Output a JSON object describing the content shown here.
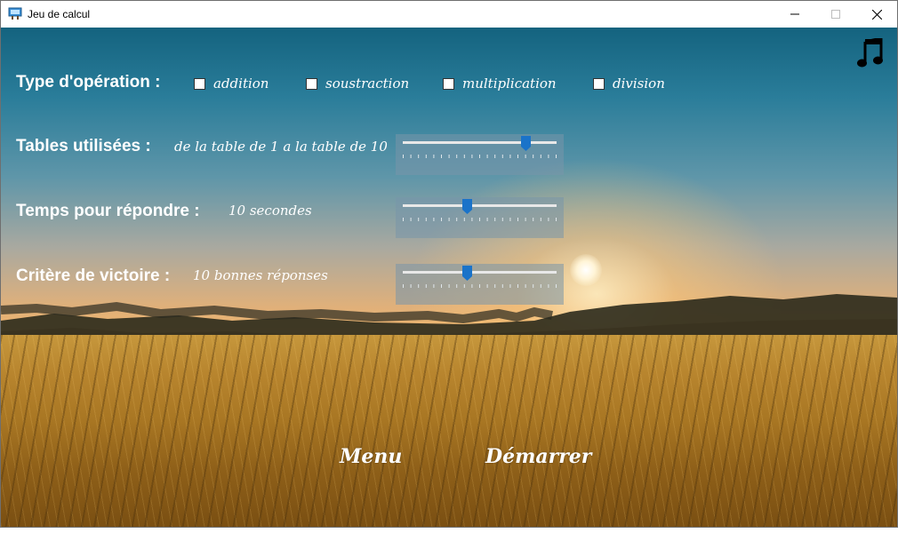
{
  "window": {
    "title": "Jeu de calcul"
  },
  "operation": {
    "label": "Type d'opération :",
    "options": [
      {
        "label": "addition",
        "checked": false
      },
      {
        "label": "soustraction",
        "checked": false
      },
      {
        "label": "multiplication",
        "checked": false
      },
      {
        "label": "division",
        "checked": false
      }
    ]
  },
  "tables": {
    "label": "Tables utilisées :",
    "value_text": "de la table de 1 a la table de 10",
    "slider_fraction": 0.8
  },
  "time": {
    "label": "Temps pour répondre :",
    "value_text": "10 secondes",
    "slider_fraction": 0.42
  },
  "victory": {
    "label": "Critère de victoire :",
    "value_text": "10 bonnes réponses",
    "slider_fraction": 0.42
  },
  "buttons": {
    "menu": "Menu",
    "start": "Démarrer"
  },
  "icons": {
    "app": "app-icon",
    "music": "music-note-icon"
  },
  "colors": {
    "slider_thumb": "#1a73c9"
  }
}
